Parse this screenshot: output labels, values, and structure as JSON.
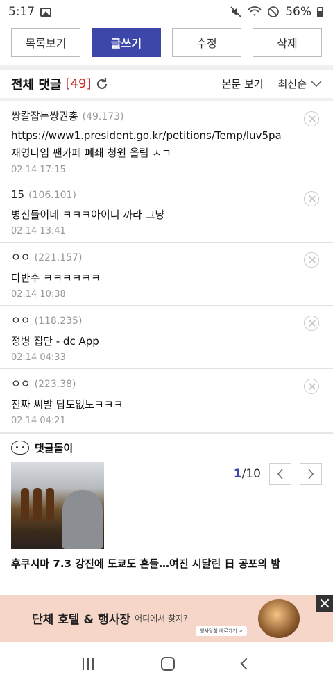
{
  "status": {
    "time": "5:17",
    "battery": "56%"
  },
  "actions": {
    "list_label": "목록보기",
    "write_label": "글쓰기",
    "edit_label": "수정",
    "delete_label": "삭제"
  },
  "comments_header": {
    "title": "전체 댓글",
    "count": "[49]",
    "view_body": "본문 보기",
    "sort": "최신순"
  },
  "comments": [
    {
      "author": "쌍칼잡는쌍권총",
      "ip": "(49.173)",
      "body_line1": "https://www1.president.go.kr/petitions/Temp/luv5pa",
      "body_line2": "재영타임 팬카페 폐쇄 청원 올림 ㅅㄱ",
      "date": "02.14 17:15"
    },
    {
      "author": "15",
      "ip": "(106.101)",
      "body": "병신들이네 ㅋㅋㅋ아이디 까라 그냥",
      "date": "02.14 13:41"
    },
    {
      "author": "ㅇㅇ",
      "ip": "(221.157)",
      "body": "다반수 ㅋㅋㅋㅋㅋㅋ",
      "date": "02.14 10:38"
    },
    {
      "author": "ㅇㅇ",
      "ip": "(118.235)",
      "body": "정병 집단 - dc App",
      "date": "02.14 04:33"
    },
    {
      "author": "ㅇㅇ",
      "ip": "(223.38)",
      "body": "진짜 씨발 답도없노ㅋㅋㅋ",
      "date": "02.14 04:21"
    }
  ],
  "bot": {
    "title": "댓글돌이",
    "page_current": "1",
    "page_total": "/10",
    "article_title": "후쿠시마 7.3 강진에 도쿄도 흔들…여진 시달린 日 공포의 밤"
  },
  "ad": {
    "title": "단체 호텔 & 행사장",
    "subtitle": "어디에서 찾지?",
    "cta": "행사당첨 바로가기 >"
  },
  "colors": {
    "primary": "#3d47a9",
    "count_red": "#c62828",
    "ad_bg": "#f6d6c8"
  }
}
